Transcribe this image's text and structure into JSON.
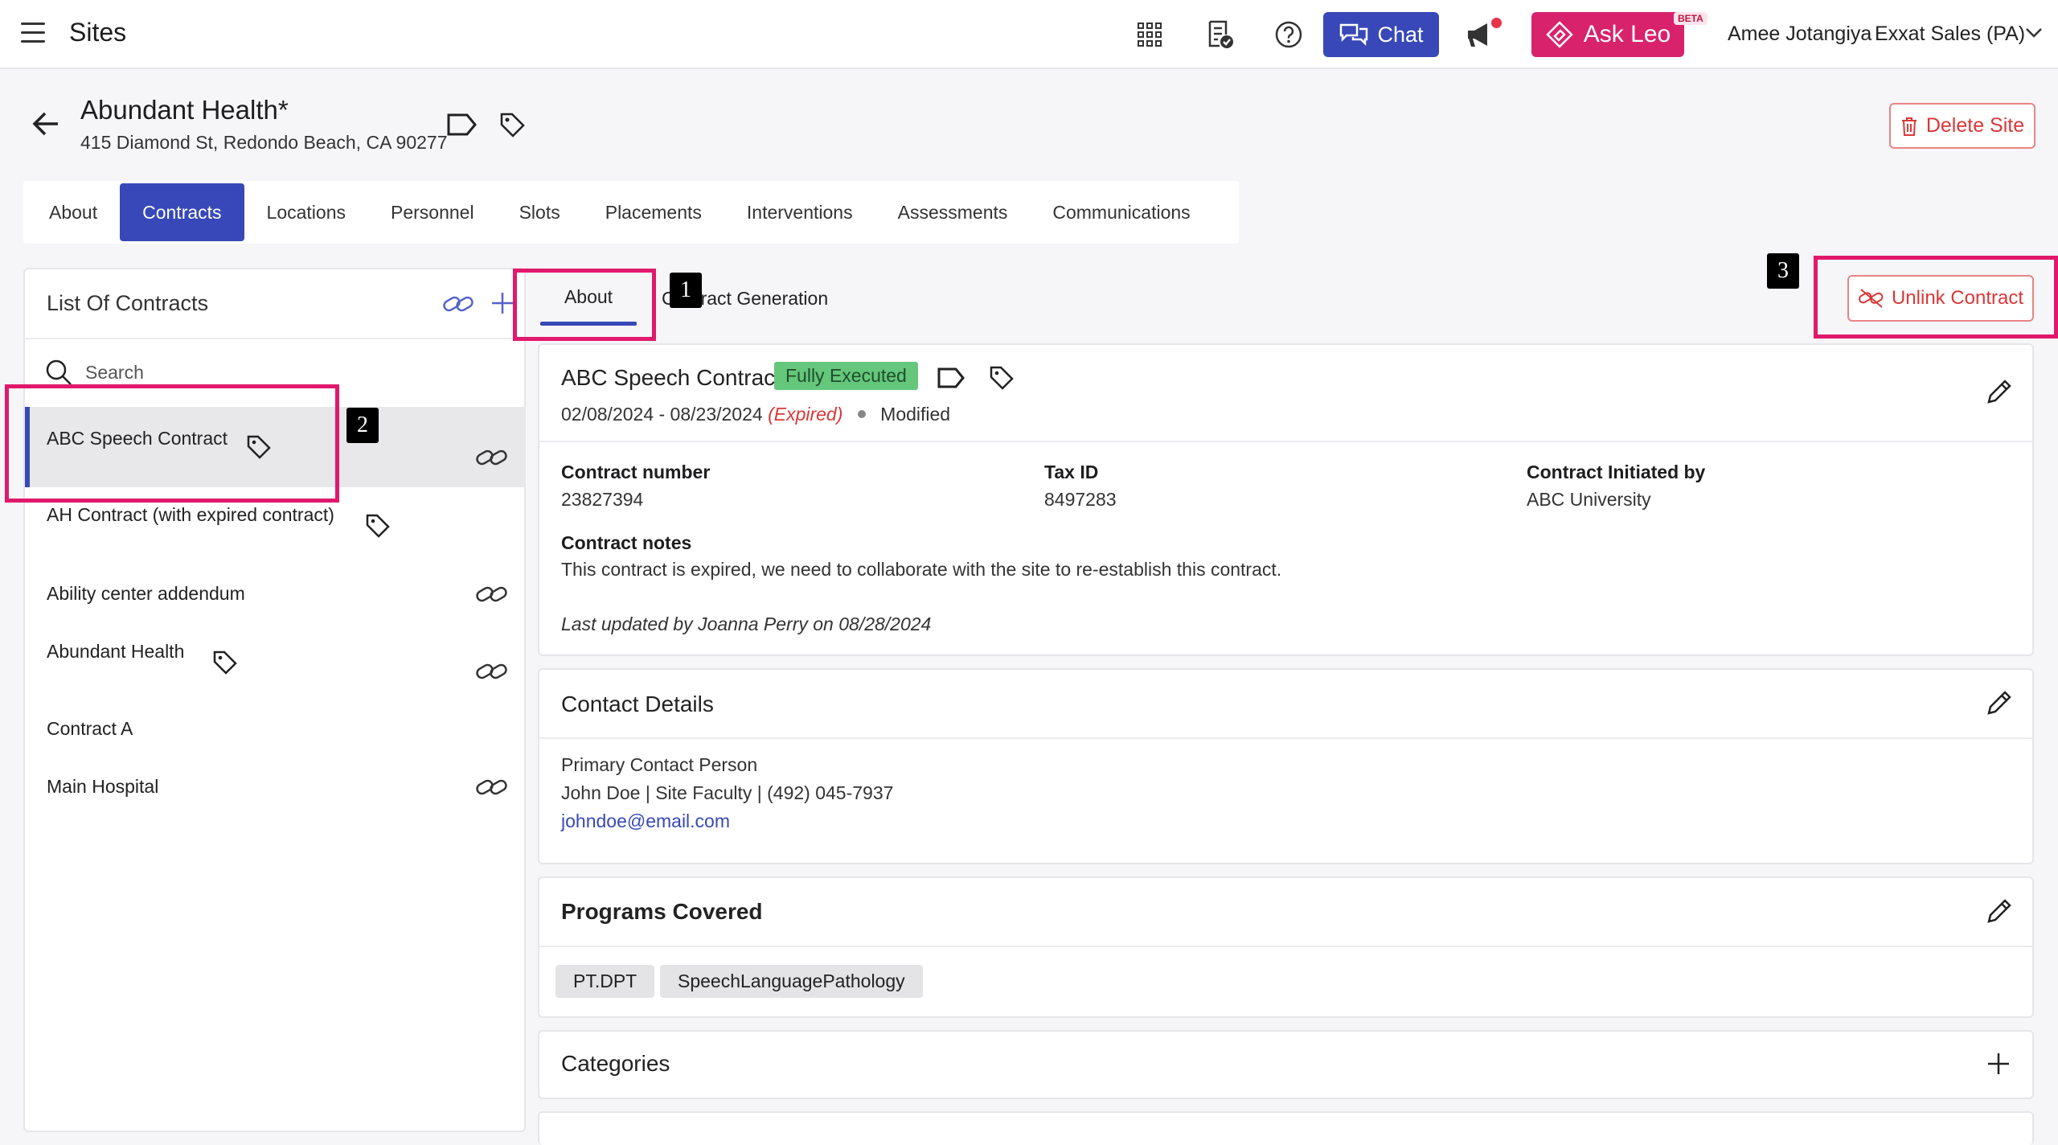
{
  "topbar": {
    "app_title": "Sites",
    "chat_label": "Chat",
    "leo_label": "Ask Leo",
    "beta_label": "BETA",
    "user_name": "Amee Jotangiya",
    "user_org": "Exxat Sales (PA)"
  },
  "site": {
    "title": "Abundant Health*",
    "address": "415 Diamond St, Redondo Beach, CA 90277",
    "delete_label": "Delete Site"
  },
  "tabs": [
    "About",
    "Contracts",
    "Locations",
    "Personnel",
    "Slots",
    "Placements",
    "Interventions",
    "Assessments",
    "Communications"
  ],
  "active_tab": "Contracts",
  "contracts_list": {
    "title": "List Of Contracts",
    "search_placeholder": "Search",
    "items": [
      {
        "name": "ABC Speech Contract"
      },
      {
        "name": "AH Contract (with expired contract)"
      },
      {
        "name": "Ability center addendum"
      },
      {
        "name": "Abundant Health"
      },
      {
        "name": "Contract A"
      },
      {
        "name": "Main Hospital"
      }
    ]
  },
  "sub_tabs": {
    "about": "About",
    "generation": "Contract Generation"
  },
  "unlink_label": "Unlink Contract",
  "contract": {
    "name": "ABC Speech Contract",
    "status": "Fully Executed",
    "date_range": "02/08/2024 - 08/23/2024",
    "expired_label": "(Expired)",
    "modified_label": "Modified",
    "number_label": "Contract number",
    "number_value": "23827394",
    "tax_label": "Tax ID",
    "tax_value": "8497283",
    "initiated_label": "Contract Initiated by",
    "initiated_value": "ABC University",
    "notes_label": "Contract notes",
    "notes_value": "This contract is expired, we need to collaborate with the site to re-establish this contract.",
    "last_updated": "Last updated by Joanna Perry on 08/28/2024"
  },
  "contact": {
    "title": "Contact Details",
    "primary_label": "Primary Contact Person",
    "primary_value": "John Doe | Site Faculty | (492) 045-7937",
    "email": "johndoe@email.com"
  },
  "programs": {
    "title": "Programs Covered",
    "chips": [
      "PT.DPT",
      "SpeechLanguagePathology"
    ]
  },
  "categories": {
    "title": "Categories"
  },
  "markers": [
    "1",
    "2",
    "3"
  ],
  "colors": {
    "primary": "#3848b8",
    "leo": "#d8226c",
    "danger": "#d93838",
    "status_green": "#64c77c",
    "highlight": "#e0196c"
  }
}
